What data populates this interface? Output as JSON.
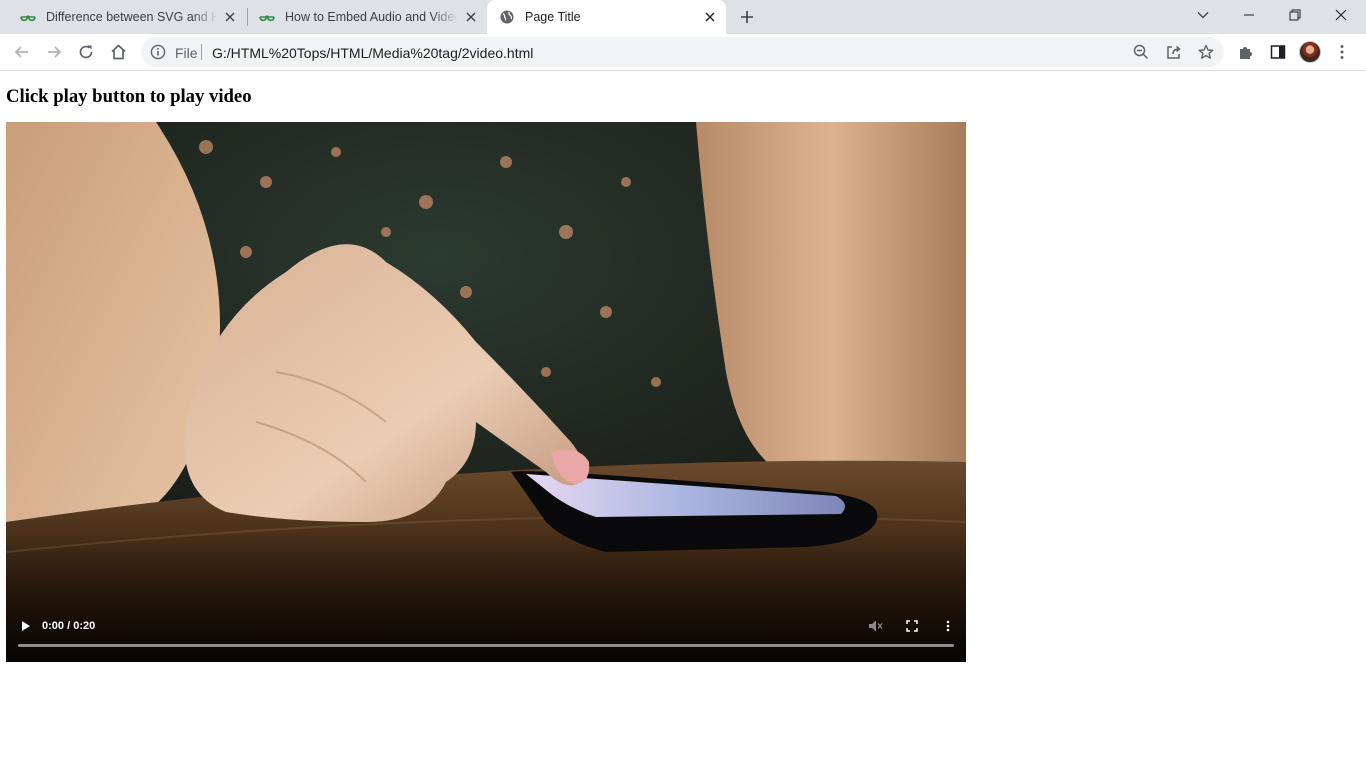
{
  "browser": {
    "tabs": [
      {
        "title": "Difference between SVG and HTML",
        "favicon": "gfg-icon",
        "active": false
      },
      {
        "title": "How to Embed Audio and Video",
        "favicon": "gfg-icon",
        "active": false
      },
      {
        "title": "Page Title",
        "favicon": "globe-icon",
        "active": true
      }
    ],
    "address": {
      "scheme_label": "File",
      "url": "G:/HTML%20Tops/HTML/Media%20tag/2video.html"
    }
  },
  "page": {
    "heading": "Click play button to play video"
  },
  "video": {
    "current_time": "0:00",
    "time_separator": " / ",
    "duration": "0:20",
    "progress": 0,
    "muted": true,
    "controls": [
      "play-icon",
      "mute-icon",
      "fullscreen-icon",
      "more-options-icon"
    ]
  },
  "colors": {
    "tabstrip": "#dee1e6",
    "active_tab": "#ffffff",
    "omnibox": "#f1f3f4",
    "gfg_green": "#2f8d46"
  }
}
